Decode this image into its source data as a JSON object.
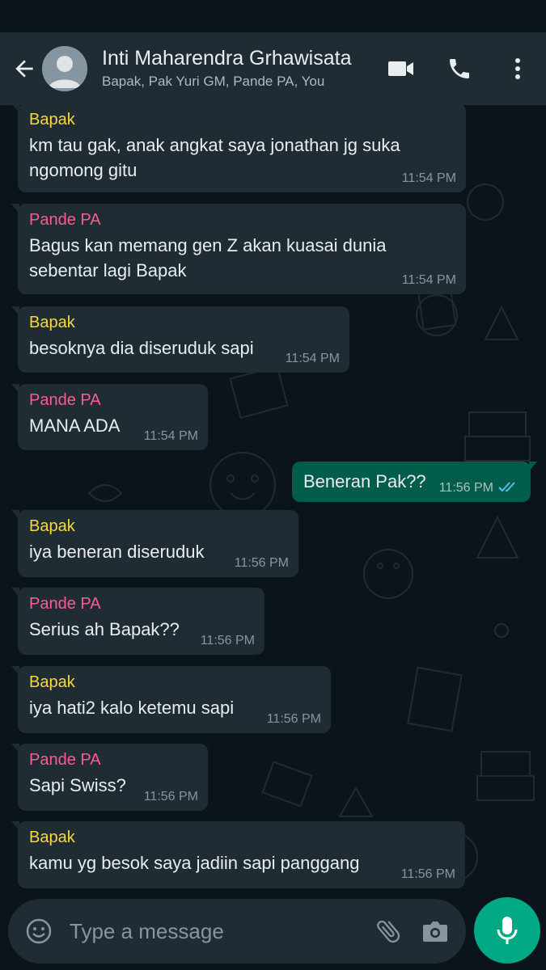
{
  "header": {
    "title": "Inti Maharendra Grhawisata",
    "subtitle": "Bapak, Pak Yuri GM, Pande PA, You"
  },
  "colors": {
    "sender_bapak": "#f7d93d",
    "sender_pande": "#ff5b8f",
    "incoming_bubble": "#1f2c33",
    "outgoing_bubble": "#005c4b",
    "accent": "#00a884",
    "read_ticks": "#53bdeb"
  },
  "messages": [
    {
      "sender": "Bapak",
      "text": "km tau gak, anak angkat saya jonathan jg suka ngomong gitu",
      "time": "11:54 PM"
    },
    {
      "sender": "Pande PA",
      "text": "Bagus kan memang gen Z akan kuasai dunia sebentar lagi Bapak",
      "time": "11:54 PM"
    },
    {
      "sender": "Bapak",
      "text": "besoknya dia diseruduk sapi",
      "time": "11:54 PM"
    },
    {
      "sender": "Pande PA",
      "text": "MANA ADA",
      "time": "11:54 PM"
    },
    {
      "sender": "",
      "text": "Beneran Pak??",
      "time": "11:56 PM",
      "outgoing": true,
      "status": "read"
    },
    {
      "sender": "Bapak",
      "text": "iya beneran diseruduk",
      "time": "11:56 PM"
    },
    {
      "sender": "Pande PA",
      "text": "Serius ah Bapak??",
      "time": "11:56 PM"
    },
    {
      "sender": "Bapak",
      "text": "iya hati2 kalo ketemu sapi",
      "time": "11:56 PM"
    },
    {
      "sender": "Pande PA",
      "text": "Sapi Swiss?",
      "time": "11:56 PM"
    },
    {
      "sender": "Bapak",
      "text": "kamu yg besok saya jadiin sapi panggang",
      "time": "11:56 PM"
    }
  ],
  "composer": {
    "placeholder": "Type a message"
  },
  "icons": {
    "back": "arrow-left-icon",
    "video": "video-camera-icon",
    "call": "phone-icon",
    "menu": "more-vert-icon",
    "emoji": "emoji-icon",
    "attach": "paperclip-icon",
    "camera": "camera-icon",
    "mic": "microphone-icon"
  }
}
